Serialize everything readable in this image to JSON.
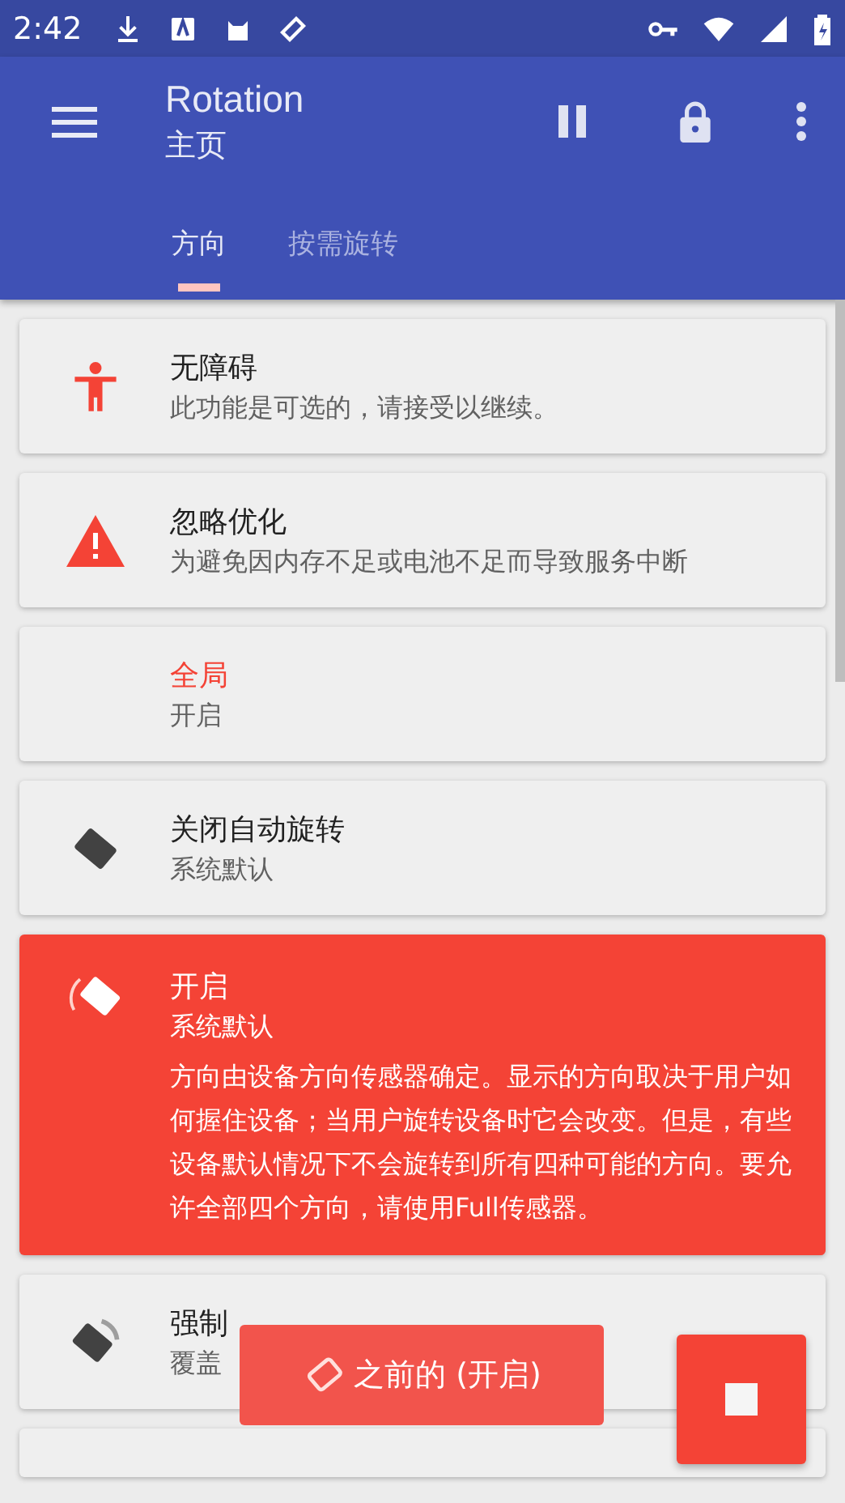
{
  "status_bar": {
    "time": "2:42"
  },
  "toolbar": {
    "title": "Rotation",
    "subtitle": "主页"
  },
  "tabs": [
    {
      "label": "方向",
      "selected": true
    },
    {
      "label": "按需旋转",
      "selected": false
    }
  ],
  "items": [
    {
      "title": "无障碍",
      "subtitle": "此功能是可选的，请接受以继续。",
      "accent": false,
      "selected": false
    },
    {
      "title": "忽略优化",
      "subtitle": "为避免因内存不足或电池不足而导致服务中断",
      "accent": false,
      "selected": false
    },
    {
      "title": "全局",
      "subtitle": "开启",
      "accent": true,
      "selected": false
    },
    {
      "title": "关闭自动旋转",
      "subtitle": "系统默认",
      "accent": false,
      "selected": false
    },
    {
      "title": "开启",
      "subtitle": "系统默认",
      "accent": false,
      "selected": true,
      "description": "方向由设备方向传感器确定。显示的方向取决于用户如何握住设备；当用户旋转设备时它会改变。但是，有些设备默认情况下不会旋转到所有四种可能的方向。要允许全部四个方向，请使用Full传感器。"
    },
    {
      "title": "强制",
      "subtitle": "覆盖",
      "accent": false,
      "selected": false
    }
  ],
  "toast": {
    "text": "之前的 (开启)"
  }
}
